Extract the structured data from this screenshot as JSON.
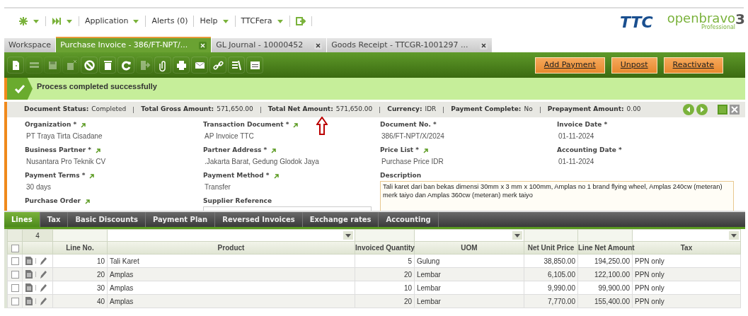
{
  "nav": [
    {
      "kind": "star",
      "dropdown": true
    },
    {
      "kind": "skip",
      "dropdown": true
    },
    {
      "kind": "text",
      "label": "Application",
      "dropdown": true
    },
    {
      "kind": "text",
      "label": "Alerts (0)",
      "dropdown": false
    },
    {
      "kind": "text",
      "label": "Help",
      "dropdown": true
    },
    {
      "kind": "text",
      "label": "TTCFera",
      "dropdown": true
    },
    {
      "kind": "logout",
      "dropdown": false
    }
  ],
  "logos": {
    "company": "TTC",
    "product": "openbravo",
    "edition": "Professional",
    "version": "3"
  },
  "tabs": [
    {
      "label": "Workspace",
      "selected": false,
      "closable": false
    },
    {
      "label": "Purchase Invoice - 386/FT-NPT/...",
      "selected": true,
      "closable": true
    },
    {
      "label": "GL Journal - 10000452",
      "selected": false,
      "closable": true
    },
    {
      "label": "Goods Receipt - TTCGR-1001297 ...",
      "selected": false,
      "closable": true
    }
  ],
  "toolbar": [
    {
      "kind": "new",
      "disabled": false
    },
    {
      "kind": "grid",
      "disabled": true
    },
    {
      "kind": "save",
      "disabled": true
    },
    {
      "kind": "undo",
      "disabled": true
    },
    {
      "kind": "cancel",
      "disabled": false
    },
    {
      "kind": "delete",
      "disabled": false
    },
    {
      "kind": "refresh",
      "disabled": false
    },
    {
      "kind": "export",
      "disabled": true
    },
    {
      "kind": "attach",
      "disabled": false
    },
    {
      "kind": "print",
      "disabled": false
    },
    {
      "kind": "email",
      "disabled": false
    },
    {
      "kind": "link",
      "disabled": false
    },
    {
      "kind": "tools",
      "disabled": false
    },
    {
      "kind": "layout",
      "disabled": false
    }
  ],
  "actions": [
    {
      "label": "Add Payment"
    },
    {
      "label": "Unpost"
    },
    {
      "label": "Reactivate"
    }
  ],
  "message": "Process completed successfully",
  "status_bar": [
    {
      "label": "Document Status:",
      "value": "Completed"
    },
    {
      "label": "Total Gross Amount:",
      "value": "571,650.00"
    },
    {
      "label": "Total Net Amount:",
      "value": "571,650.00"
    },
    {
      "label": "Currency:",
      "value": "IDR"
    },
    {
      "label": "Payment Complete:",
      "value": "No"
    },
    {
      "label": "Prepayment Amount:",
      "value": "0.00"
    }
  ],
  "fields": [
    {
      "kind": "text",
      "label": "Organization *",
      "link": true,
      "value": "PT Traya Tirta Cisadane"
    },
    {
      "kind": "text",
      "label": "Transaction Document *",
      "link": true,
      "value": "AP Invoice TTC"
    },
    {
      "kind": "text",
      "label": "Document No. *",
      "link": false,
      "value": "386/FT-NPT/X/2024"
    },
    {
      "kind": "text",
      "label": "Invoice Date *",
      "link": false,
      "value": "01-11-2024"
    },
    {
      "kind": "text",
      "label": "Business Partner *",
      "link": true,
      "value": "Nusantara Pro Teknik CV"
    },
    {
      "kind": "text",
      "label": "Partner Address *",
      "link": true,
      "value": ".Jakarta Barat, Gedung Glodok Jaya"
    },
    {
      "kind": "text",
      "label": "Price List *",
      "link": true,
      "value": "Purchase Price IDR"
    },
    {
      "kind": "text",
      "label": "Accounting Date *",
      "link": false,
      "value": "01-11-2024"
    },
    {
      "kind": "text",
      "label": "Payment Terms *",
      "link": true,
      "value": "30 days"
    },
    {
      "kind": "text",
      "label": "Payment Method *",
      "link": true,
      "value": "Transfer"
    },
    {
      "kind": "textarea",
      "label": "Description",
      "link": false,
      "value": "Tali karet dari ban bekas dimensi 30mm x 3 mm x 100mm, Amplas no 1 brand flying wheel, Amplas 240cw (meteran) merk taiyo dan Amplas 360cw (meteran) merk taiyo"
    },
    {
      "kind": "text",
      "label": "Purchase Order",
      "link": true
    },
    {
      "kind": "input",
      "label": "Supplier Reference",
      "link": false
    }
  ],
  "subtabs": [
    {
      "label": "Lines",
      "selected": true
    },
    {
      "label": "Tax",
      "selected": false
    },
    {
      "label": "Basic Discounts",
      "selected": false
    },
    {
      "label": "Payment Plan",
      "selected": false
    },
    {
      "label": "Reversed Invoices",
      "selected": false
    },
    {
      "label": "Exchange rates",
      "selected": false
    },
    {
      "label": "Accounting",
      "selected": false
    }
  ],
  "grid": {
    "count": "4",
    "all_checked": false,
    "columns": [
      {
        "label": "Line No.",
        "dropdown": false
      },
      {
        "label": "Product",
        "dropdown": true
      },
      {
        "label": "Invoiced Quantity",
        "dropdown": false
      },
      {
        "label": "UOM",
        "dropdown": true
      },
      {
        "label": "Net Unit Price",
        "dropdown": false
      },
      {
        "label": "Line Net Amount",
        "dropdown": false
      },
      {
        "label": "Tax",
        "dropdown": true
      }
    ],
    "rows": [
      {
        "checked": false,
        "cells": [
          "10",
          "Tali Karet",
          "5",
          "Gulung",
          "38,850.00",
          "194,250.00",
          "PPN only"
        ]
      },
      {
        "checked": false,
        "cells": [
          "20",
          "Amplas",
          "20",
          "Lembar",
          "6,105.00",
          "122,100.00",
          "PPN only"
        ]
      },
      {
        "checked": false,
        "cells": [
          "30",
          "Amplas",
          "10",
          "Lembar",
          "9,990.00",
          "99,900.00",
          "PPN only"
        ]
      },
      {
        "checked": false,
        "cells": [
          "40",
          "Amplas",
          "20",
          "Lembar",
          "7,770.00",
          "155,400.00",
          "PPN only"
        ]
      }
    ]
  }
}
